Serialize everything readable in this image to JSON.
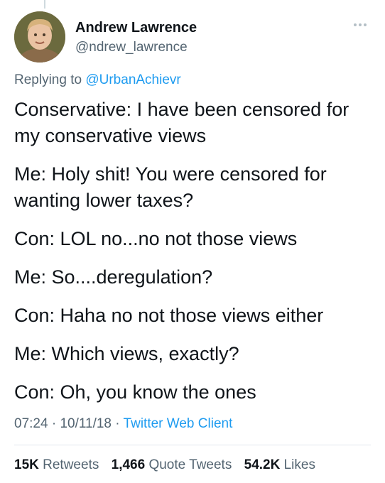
{
  "author": {
    "name": "Andrew Lawrence",
    "handle": "@ndrew_lawrence"
  },
  "reply": {
    "prefix": "Replying to",
    "mention": "@UrbanAchievr"
  },
  "tweet": {
    "paragraphs": [
      "Conservative: I have been censored for my conservative views",
      "Me: Holy shit! You were censored for wanting lower taxes?",
      "Con: LOL no...no not those views",
      "Me: So....deregulation?",
      "Con: Haha no not those views either",
      "Me: Which views, exactly?",
      "Con: Oh, you know the ones"
    ]
  },
  "meta": {
    "time": "07:24",
    "date": "10/11/18",
    "separator": "·",
    "client": "Twitter Web Client"
  },
  "stats": {
    "retweets_count": "15K",
    "retweets_label": "Retweets",
    "quotes_count": "1,466",
    "quotes_label": "Quote Tweets",
    "likes_count": "54.2K",
    "likes_label": "Likes"
  },
  "colors": {
    "link": "#1d9bf0",
    "muted": "#536471",
    "text": "#0f1419"
  },
  "icons": {
    "more": "more-dots-icon"
  }
}
